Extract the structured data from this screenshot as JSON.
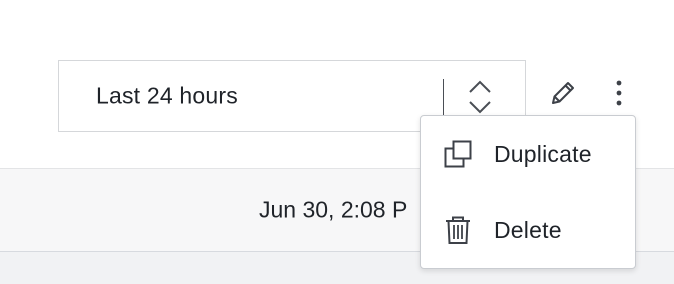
{
  "toolbar": {
    "time_range": {
      "value": "Last 24 hours",
      "icon": "chevron-up-down-icon"
    },
    "edit_icon": "pencil-icon",
    "more_icon": "vertical-ellipsis-icon"
  },
  "table": {
    "date_text": "Jun 30, 2:08 P"
  },
  "context_menu": {
    "items": [
      {
        "label": "Duplicate",
        "icon": "duplicate-icon"
      },
      {
        "label": "Delete",
        "icon": "trash-icon"
      }
    ]
  },
  "colors": {
    "text": "#1f2329",
    "border": "#d5d7da",
    "strip_background": "#f7f7f8"
  }
}
